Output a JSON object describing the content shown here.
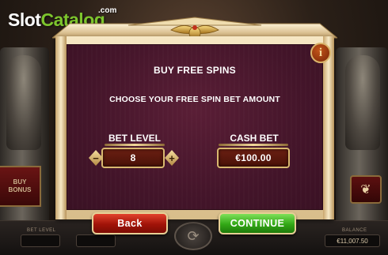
{
  "watermark": {
    "brand_slot": "Slot",
    "brand_catalog": "Catalog",
    "brand_com": ".com"
  },
  "background": {
    "buy_bonus_line1": "BUY",
    "buy_bonus_line2": "BONUS",
    "bottom_bar": {
      "left_label": "BET LEVEL",
      "balance_label": "BALANCE",
      "balance_value": "€11,007.50"
    }
  },
  "dialog": {
    "title": "BUY FREE SPINS",
    "subtitle": "CHOOSE YOUR FREE SPIN BET AMOUNT",
    "info_glyph": "i",
    "bet_level": {
      "label": "BET LEVEL",
      "value": "8",
      "decrease_glyph": "−",
      "increase_glyph": "+"
    },
    "cash_bet": {
      "label": "CASH BET",
      "value": "€100.00"
    },
    "buttons": {
      "back": "Back",
      "continue": "CONTINUE"
    }
  },
  "colors": {
    "logo_catalog": "#7dc52d",
    "panel": "#44152a",
    "frame_gold": "#d9b86f",
    "back_button": "#a11308",
    "continue_button": "#32a816"
  },
  "icons": {
    "info": "info-icon",
    "scarab_crest": "scarab-icon",
    "spin": "spin-icon",
    "leaf": "leaf-icon"
  }
}
